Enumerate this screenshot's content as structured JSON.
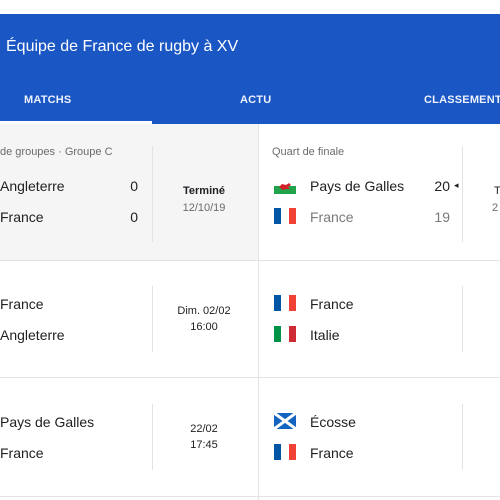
{
  "app": {
    "title": "Équipe de France de rugby à XV"
  },
  "tabs": [
    {
      "label": "MATCHS"
    },
    {
      "label": "ACTU"
    },
    {
      "label": "CLASSEMENTS"
    }
  ],
  "colors": {
    "header": "#1a56c4",
    "france_blue": "#0055a4",
    "france_red": "#ef4135",
    "italy_green": "#009246",
    "wales_green": "#20a34a",
    "wales_red": "#d4202a",
    "scotland_blue": "#1565c0"
  },
  "matches": [
    {
      "stage": "de groupes · Groupe C",
      "home": "Angleterre",
      "away": "France",
      "home_score": "0",
      "away_score": "0",
      "status": "Terminé",
      "date": "12/10/19"
    },
    {
      "stage": "Quart de finale",
      "home": "Pays de Galles",
      "home_flag": "wales-flag-icon",
      "away": "France",
      "away_flag": "france-flag-icon",
      "home_score": "20",
      "away_score": "19",
      "winner_marker": "◂",
      "status_partial": "T",
      "date_partial": "2"
    },
    {
      "home": "France",
      "away": "Angleterre",
      "date": "Dim. 02/02",
      "time": "16:00"
    },
    {
      "home": "France",
      "home_flag": "france-flag-icon",
      "away": "Italie",
      "away_flag": "italy-flag-icon"
    },
    {
      "home": "Pays de Galles",
      "away": "France",
      "date": "22/02",
      "time": "17:45"
    },
    {
      "home": "Écosse",
      "home_flag": "scotland-flag-icon",
      "away": "France",
      "away_flag": "france-flag-icon"
    }
  ]
}
